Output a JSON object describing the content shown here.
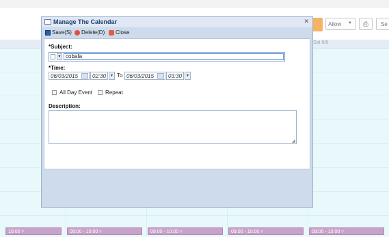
{
  "background": {
    "toolbar": {
      "allow_label": "Allow",
      "print_icon": "printer-icon",
      "se_label": "Se"
    },
    "header": {
      "left_day": "",
      "right_day": "Sat 6/6"
    },
    "events": [
      {
        "label": "10:00"
      },
      {
        "label": "09:00 - 10:00"
      },
      {
        "label": "09:00 - 10:00"
      },
      {
        "label": "09:00 - 10:00"
      },
      {
        "label": "09:00 - 10:00"
      }
    ]
  },
  "dialog": {
    "title": "Manage The Calendar",
    "toolbar": {
      "save": "Save(S)",
      "delete": "Delete(D)",
      "close": "Close"
    },
    "subject": {
      "label": "*Subject:",
      "value": "cobafa"
    },
    "time": {
      "label": "*Time:",
      "start_date": "06/03/2015",
      "start_time": "02:30",
      "to": "To",
      "end_date": "06/03/2015",
      "end_time": "03:30"
    },
    "options": {
      "all_day": "All Day Event",
      "repeat": "Repeat"
    },
    "description": {
      "label": "Description:",
      "value": ""
    }
  },
  "colors": {
    "calendar_bg": "#e9f9fb",
    "dialog_bg": "#cddbec",
    "event_bg": "#c7a2c9",
    "accent": "#f6b365"
  }
}
